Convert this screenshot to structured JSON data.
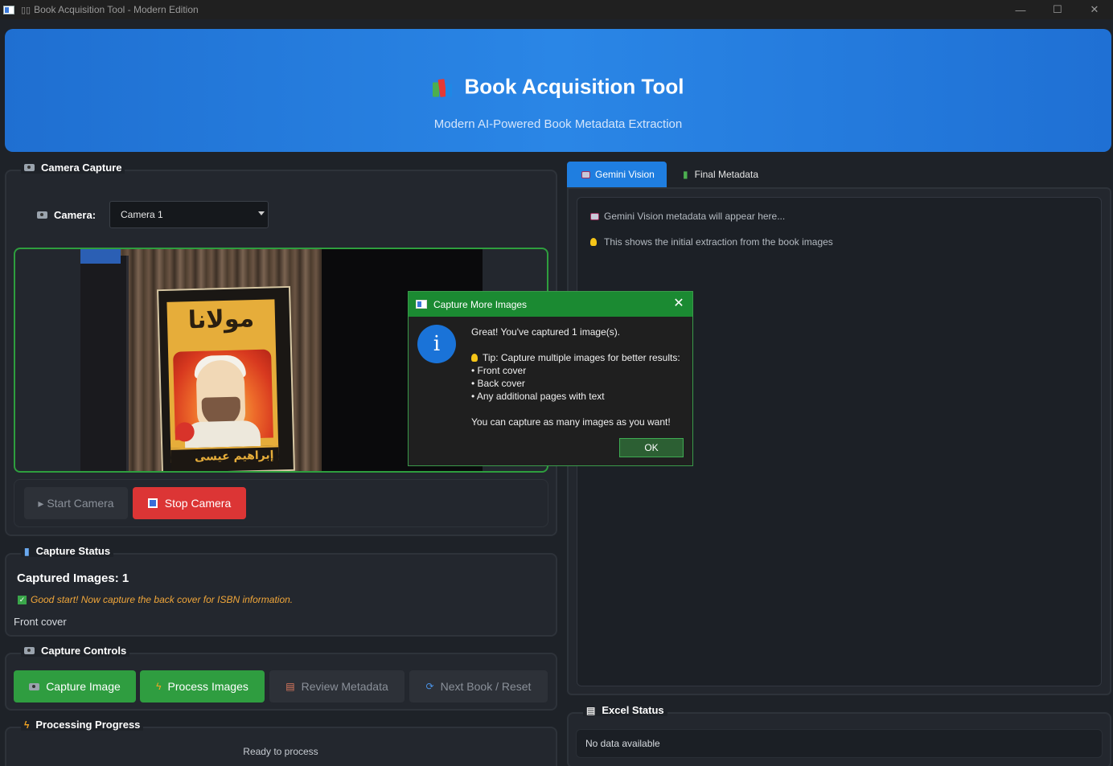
{
  "window": {
    "title": "Book Acquisition Tool - Modern Edition"
  },
  "header": {
    "title": "Book Acquisition Tool",
    "subtitle": "Modern AI-Powered Book Metadata Extraction"
  },
  "camera_capture": {
    "title": "Camera Capture",
    "camera_label": "Camera:",
    "camera_selected": "Camera 1",
    "book_title_text": "مولانا",
    "book_author_text": "إبراهيم عيسى",
    "start_label": "▸ Start Camera",
    "stop_label": "Stop Camera"
  },
  "capture_status": {
    "title": "Capture Status",
    "count_text": "Captured Images: 1",
    "message": "Good start! Now capture the back cover for ISBN information.",
    "list_text": "Front cover"
  },
  "capture_controls": {
    "title": "Capture Controls",
    "capture_label": "Capture Image",
    "process_label": "Process Images",
    "review_label": "Review Metadata",
    "next_label": "Next Book / Reset"
  },
  "processing": {
    "title": "Processing Progress",
    "status": "Ready to process"
  },
  "tabs": [
    {
      "label": "Gemini Vision",
      "active": true
    },
    {
      "label": "Final Metadata",
      "active": false
    }
  ],
  "gemini": {
    "hint1": "Gemini Vision metadata will appear here...",
    "hint2": "This shows the initial extraction from the book images"
  },
  "excel": {
    "title": "Excel Status",
    "status": "No data available"
  },
  "dialog": {
    "title": "Capture More Images",
    "line1": "Great! You've captured 1 image(s).",
    "line2": "Tip: Capture multiple images for better results:",
    "line3": "• Front cover",
    "line4": "• Back cover",
    "line5": "• Any additional pages with text",
    "line6": "You can capture as many images as you want!",
    "ok_label": "OK"
  },
  "colors": {
    "header_blue": "#2a86e6",
    "green_accent": "#2f9d40",
    "red_button": "#dc3535",
    "warning_orange": "#f0a63a",
    "tab_active": "#1f7ee0"
  },
  "icons": [
    "app-window-icon",
    "books-icon",
    "camera-icon",
    "bar-chart-icon",
    "lightning-icon",
    "robot-icon",
    "lightbulb-icon",
    "document-icon",
    "info-icon",
    "close-icon",
    "refresh-icon",
    "check-icon"
  ]
}
